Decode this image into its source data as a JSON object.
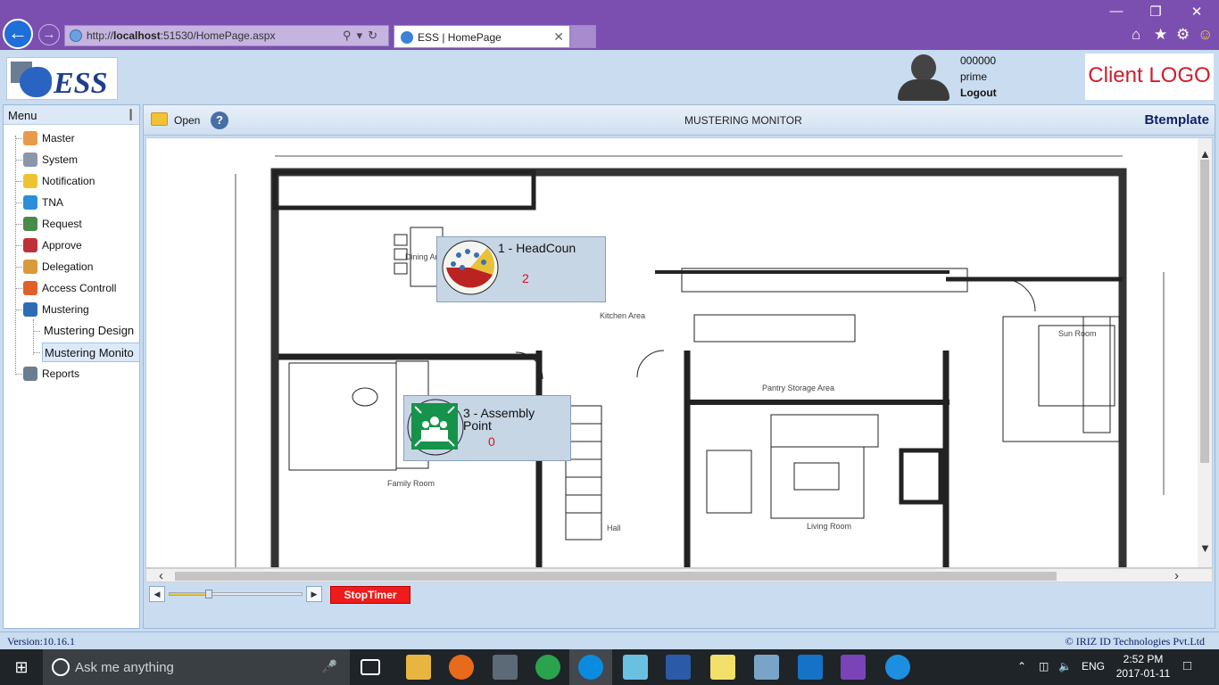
{
  "browser": {
    "url_prefix": "http://",
    "url_host": "localhost",
    "url_rest": ":51530/HomePage.aspx",
    "tab_title": "ESS | HomePage"
  },
  "header": {
    "logo_text": "ESS",
    "user_id": "000000",
    "user_name": "prime",
    "logout_label": "Logout",
    "client_logo": "Client LOGO"
  },
  "sidebar": {
    "title": "Menu",
    "items": [
      {
        "label": "Master",
        "icon": "user-icon",
        "color": "#e89a4a"
      },
      {
        "label": "System",
        "icon": "gear-icon",
        "color": "#8a97a8"
      },
      {
        "label": "Notification",
        "icon": "envelope-icon",
        "color": "#f0c233"
      },
      {
        "label": "TNA",
        "icon": "clock-icon",
        "color": "#2a8fd8"
      },
      {
        "label": "Request",
        "icon": "request-icon",
        "color": "#4a8a4a"
      },
      {
        "label": "Approve",
        "icon": "check-icon",
        "color": "#c0303a"
      },
      {
        "label": "Delegation",
        "icon": "people-icon",
        "color": "#d99a3a"
      },
      {
        "label": "Access Controll",
        "icon": "door-icon",
        "color": "#e0602a"
      },
      {
        "label": "Mustering",
        "icon": "monitor-icon",
        "color": "#2d6db5"
      },
      {
        "label": "Reports",
        "icon": "report-icon",
        "color": "#6a7d92"
      }
    ],
    "sub_items": [
      "Mustering Design",
      "Mustering Monito"
    ]
  },
  "toolbar": {
    "open_label": "Open",
    "help_label": "?",
    "title": "MUSTERING MONITOR",
    "template_name": "Btemplate"
  },
  "zones": [
    {
      "label": "1 - HeadCoun",
      "count": "2"
    },
    {
      "label": "3 - Assembly Point",
      "count": "0"
    }
  ],
  "floorplan_labels": {
    "dining": "Dining Area",
    "kitchen": "Kitchen Area",
    "pantry": "Pantry Storage Area",
    "sun": "Sun Room",
    "family": "Family Room",
    "living": "Living Room",
    "hall": "Hall"
  },
  "controls": {
    "stop_label": "StopTimer",
    "slider_level": 0.27
  },
  "footer": {
    "version": "Version:10.16.1",
    "copyright": "© IRIZ ID Technologies Pvt.Ltd"
  },
  "taskbar": {
    "search_placeholder": "Ask me anything",
    "language": "ENG",
    "time": "2:52 PM",
    "date": "2017-01-11"
  }
}
